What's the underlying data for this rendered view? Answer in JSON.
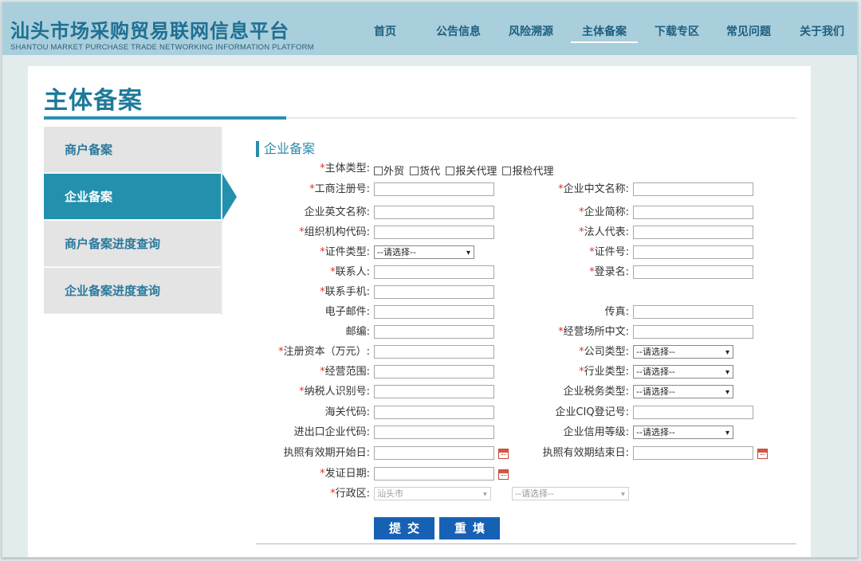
{
  "header": {
    "title": "汕头市场采购贸易联网信息平台",
    "subtitle": "SHANTOU MARKET PURCHASE TRADE NETWORKING INFORMATION PLATFORM"
  },
  "nav": {
    "items": [
      {
        "label": "首页"
      },
      {
        "label": "公告信息"
      },
      {
        "label": "风险溯源"
      },
      {
        "label": "主体备案"
      },
      {
        "label": "下载专区"
      },
      {
        "label": "常见问题"
      },
      {
        "label": "关于我们"
      }
    ],
    "active": "主体备案"
  },
  "page": {
    "title": "主体备案",
    "section_title": "企业备案"
  },
  "sidebar": {
    "items": [
      {
        "label": "商户备案"
      },
      {
        "label": "企业备案"
      },
      {
        "label": "商户备案进度查询"
      },
      {
        "label": "企业备案进度查询"
      }
    ],
    "active": "企业备案"
  },
  "form": {
    "entity_type": {
      "label": "主体类型:",
      "options": [
        "外贸",
        "货代",
        "报关代理",
        "报检代理"
      ]
    },
    "fields": {
      "reg_no": "工商注册号:",
      "cn_name": "企业中文名称:",
      "en_name": "企业英文名称:",
      "short_name": "企业简称:",
      "org_code": "组织机构代码:",
      "legal_rep": "法人代表:",
      "cert_type": "证件类型:",
      "cert_no": "证件号:",
      "contact": "联系人:",
      "login_name": "登录名:",
      "mobile": "联系手机:",
      "email": "电子邮件:",
      "fax": "传真:",
      "postcode": "邮编:",
      "biz_place_cn": "经营场所中文:",
      "reg_capital": "注册资本（万元）:",
      "company_type": "公司类型:",
      "biz_scope": "经营范围:",
      "industry_type": "行业类型:",
      "taxpayer_id": "纳税人识别号:",
      "tax_type": "企业税务类型:",
      "customs_code": "海关代码:",
      "ciq_no": "企业CIQ登记号:",
      "ie_code": "进出口企业代码:",
      "credit_level": "企业信用等级:",
      "license_start": "执照有效期开始日:",
      "license_end": "执照有效期结束日:",
      "issue_date": "发证日期:",
      "region": "行政区:"
    },
    "select_placeholder": "--请选择--",
    "region_city": "汕头市",
    "buttons": {
      "submit": "提交",
      "reset": "重填"
    }
  }
}
